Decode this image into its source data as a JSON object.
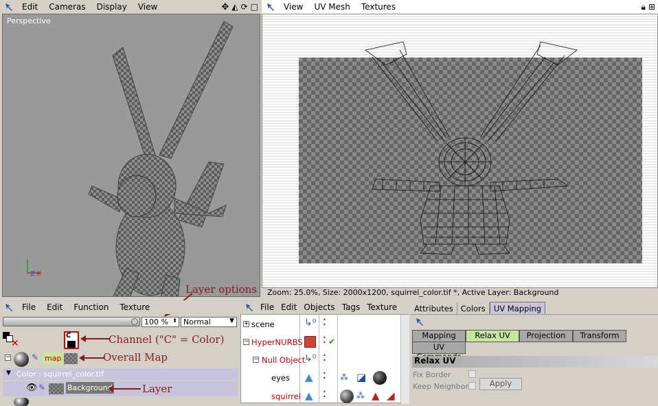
{
  "left_view": {
    "menu": [
      "Edit",
      "Cameras",
      "Display",
      "View"
    ],
    "title": "Perspective",
    "nav_icons": [
      "move-icon",
      "scale-icon",
      "rotate-icon",
      "maximize-icon"
    ]
  },
  "right_view": {
    "menu": [
      "View",
      "UV Mesh",
      "Textures"
    ],
    "status": "Zoom: 25.0%, Size: 2000x1200, squirrel_color.tif *, Active Layer: Background"
  },
  "texture_panel": {
    "menu": [
      "File",
      "Edit",
      "Function",
      "Texture"
    ],
    "opacity": "100 %",
    "blend_mode": "Normal",
    "map_label": "map",
    "color_row": "Color : squirrel_color.tif",
    "layer_name": "Background"
  },
  "annotations": {
    "layer_options": "Layer options",
    "channel": "Channel (\"C\" = Color)",
    "overall_map": "Overall Map",
    "layer": "Layer"
  },
  "objects_panel": {
    "menu": [
      "File",
      "Edit",
      "Objects",
      "Tags",
      "Texture"
    ],
    "items": [
      "scene",
      "HyperNURBS",
      "Null Object",
      "eyes",
      "squirrel"
    ]
  },
  "attributes_panel": {
    "tabs": [
      "Attributes",
      "Colors",
      "UV Mapping"
    ],
    "subtabs": [
      "Mapping",
      "Relax UV",
      "Projection",
      "Transform"
    ],
    "uv_commands": "UV Commands",
    "section_title": "Relax UV",
    "fix_border": "Fix Border",
    "keep_neighbors": "Keep Neighbors",
    "apply": "Apply"
  },
  "colors": {
    "accent_green": "#c8e6a0",
    "annotation_red": "#8b1a1a",
    "selected_red": "#cc0000"
  }
}
